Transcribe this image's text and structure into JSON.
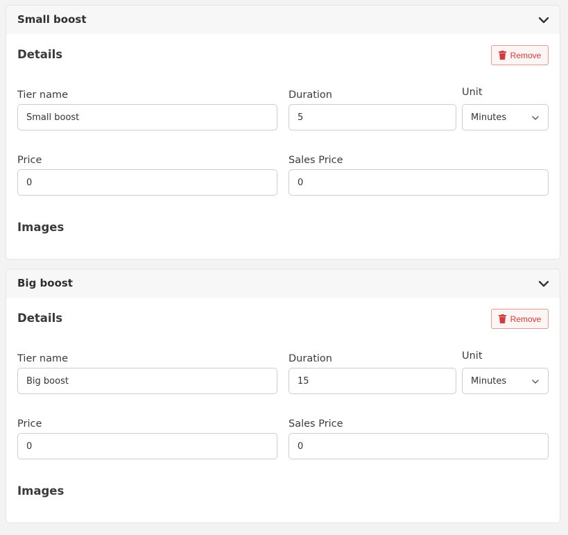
{
  "tiers": [
    {
      "title": "Small boost",
      "details_heading": "Details",
      "remove_label": "Remove",
      "tier_name_label": "Tier name",
      "tier_name_value": "Small boost",
      "duration_label": "Duration",
      "duration_value": "5",
      "unit_label": "Unit",
      "unit_value": "Minutes",
      "price_label": "Price",
      "price_value": "0",
      "sales_price_label": "Sales Price",
      "sales_price_value": "0",
      "images_heading": "Images"
    },
    {
      "title": "Big boost",
      "details_heading": "Details",
      "remove_label": "Remove",
      "tier_name_label": "Tier name",
      "tier_name_value": "Big boost",
      "duration_label": "Duration",
      "duration_value": "15",
      "unit_label": "Unit",
      "unit_value": "Minutes",
      "price_label": "Price",
      "price_value": "0",
      "sales_price_label": "Sales Price",
      "sales_price_value": "0",
      "images_heading": "Images"
    }
  ],
  "icons": {
    "collapse": "chevron-down-icon",
    "remove": "trash-icon",
    "select_caret": "chevron-down-icon"
  },
  "colors": {
    "danger": "#d23b3b",
    "danger_border": "#e39a9a",
    "page_bg": "#f3f3f3"
  }
}
